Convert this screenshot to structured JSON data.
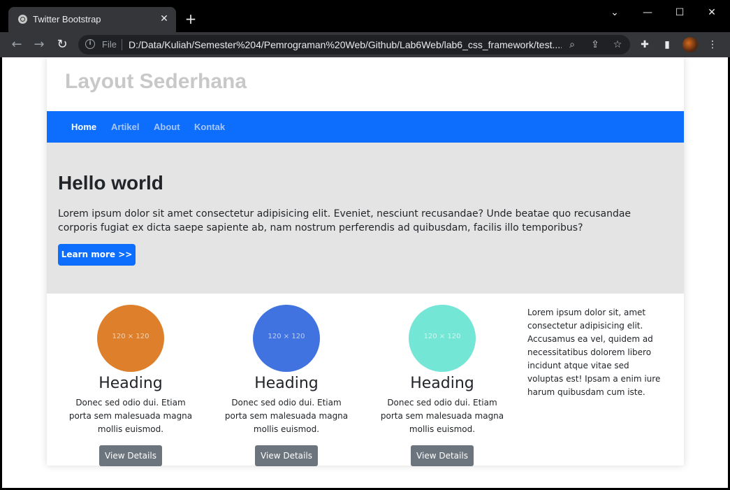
{
  "browser": {
    "tab_title": "Twitter Bootstrap",
    "tab_close": "✕",
    "new_tab": "+",
    "omnibox_scheme": "File",
    "url": "D:/Data/Kuliah/Semester%204/Pemrograman%20Web/Github/Lab6Web/lab6_css_framework/test....",
    "controls": {
      "dropdown": "⌄",
      "minimize": "—",
      "maximize": "☐",
      "close": "✕"
    }
  },
  "site": {
    "title": "Layout Sederhana",
    "nav": [
      {
        "label": "Home",
        "active": true
      },
      {
        "label": "Artikel",
        "active": false
      },
      {
        "label": "About",
        "active": false
      },
      {
        "label": "Kontak",
        "active": false
      }
    ],
    "hero": {
      "title": "Hello world",
      "text": "Lorem ipsum dolor sit amet consectetur adipisicing elit. Eveniet, nesciunt recusandae? Unde beatae quo recusandae corporis fugiat ex dicta saepe sapiente ab, nam nostrum perferendis ad quibusdam, facilis illo temporibus?",
      "button": "Learn more >>"
    },
    "columns": [
      {
        "placeholder": "120 × 120",
        "color": "#dd7f2b",
        "heading": "Heading",
        "text": "Donec sed odio dui. Etiam porta sem malesuada magna mollis euismod.",
        "button": "View Details"
      },
      {
        "placeholder": "120 × 120",
        "color": "#4173e0",
        "heading": "Heading",
        "text": "Donec sed odio dui. Etiam porta sem malesuada magna mollis euismod.",
        "button": "View Details"
      },
      {
        "placeholder": "120 × 120",
        "color": "#74e6d5",
        "heading": "Heading",
        "text": "Donec sed odio dui. Etiam porta sem malesuada magna mollis euismod.",
        "button": "View Details"
      }
    ],
    "aside": "Lorem ipsum dolor sit, amet consectetur adipisicing elit. Accusamus ea vel, quidem ad necessitatibus dolorem libero incidunt atque vitae sed voluptas est! Ipsam a enim iure harum quibusdam cum iste."
  }
}
